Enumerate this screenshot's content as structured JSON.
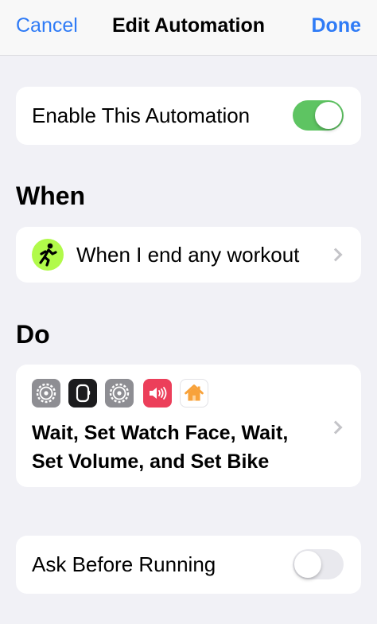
{
  "navbar": {
    "cancel_label": "Cancel",
    "title": "Edit Automation",
    "done_label": "Done"
  },
  "enable_row": {
    "label": "Enable This Automation",
    "enabled": true
  },
  "when_section": {
    "title": "When",
    "trigger_label": "When I end any workout",
    "trigger_icon": "running-figure-icon"
  },
  "do_section": {
    "title": "Do",
    "action_icons": [
      "settings-gear-icon",
      "apple-watch-icon",
      "settings-gear-icon",
      "volume-speaker-icon",
      "home-icon"
    ],
    "actions_line1": "Wait, Set Watch Face, Wait,",
    "actions_line2": "Set Volume, and Set Bike"
  },
  "ask_row": {
    "label": "Ask Before Running",
    "enabled": false
  },
  "colors": {
    "accent": "#2f7bf6",
    "toggle_on": "#5ec462",
    "workout_green": "#b1fa4a",
    "volume_red": "#ec3f5a",
    "home_orange": "#f8a23a"
  }
}
